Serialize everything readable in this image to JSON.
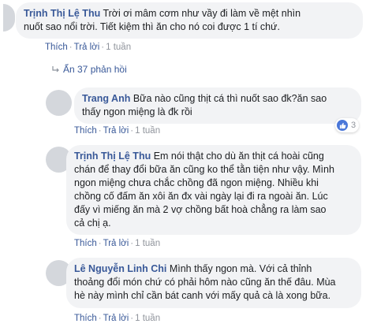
{
  "comments": [
    {
      "name": "Trịnh Thị Lệ Thu",
      "lines": [
        " Trời ơi mâm cơm như vầy đi làm về mệt nhìn",
        "nuốt sao nổi trời. Tiết kiệm thì ăn cho nó coi được 1 tí chứ."
      ],
      "like": "Thích",
      "reply": "Trả lời",
      "time": "1 tuần"
    },
    {
      "name": "Trang Anh",
      "lines": [
        " Bữa nào cũng thịt cá thì nuốt sao đk?ăn sao",
        "thấy ngon miệng là đk rồi"
      ],
      "like": "Thích",
      "reply": "Trả lời",
      "time": "1 tuần",
      "reaction_count": "3"
    },
    {
      "name": "Trịnh Thị Lệ Thu",
      "lines": [
        " Em nói thật cho dù ăn thịt cá hoài cũng",
        "chán để thay đổi bữa ăn cũng ko thể tằn tiện như vậy. Mình",
        "ngon miệng chưa chắc chồng đã ngon miệng. Nhiều khi",
        "chồng cố đấm ăn xôi ăn đx vài ngày lại đi ra ngoài ăn. Lúc",
        "đấy vì miếng ăn mà 2 vợ chồng bất hoà chẳng ra làm sao",
        "cả chị ạ."
      ],
      "like": "Thích",
      "reply": "Trả lời",
      "time": "1 tuần"
    },
    {
      "name": "Lê Nguyễn Linh Chi",
      "lines": [
        " Mình thấy ngon mà. Với cả thỉnh",
        "thoảng đổi món chứ có phải hôm nào cũng ăn thế đâu. Mùa",
        "hè này mình chỉ cần bát canh với mấy quả cà là xong bữa."
      ],
      "like": "Thích",
      "reply": "Trả lời",
      "time": "1 tuần"
    }
  ],
  "hidden_replies": "Ẩn 37 phản hồi",
  "dot": "·"
}
